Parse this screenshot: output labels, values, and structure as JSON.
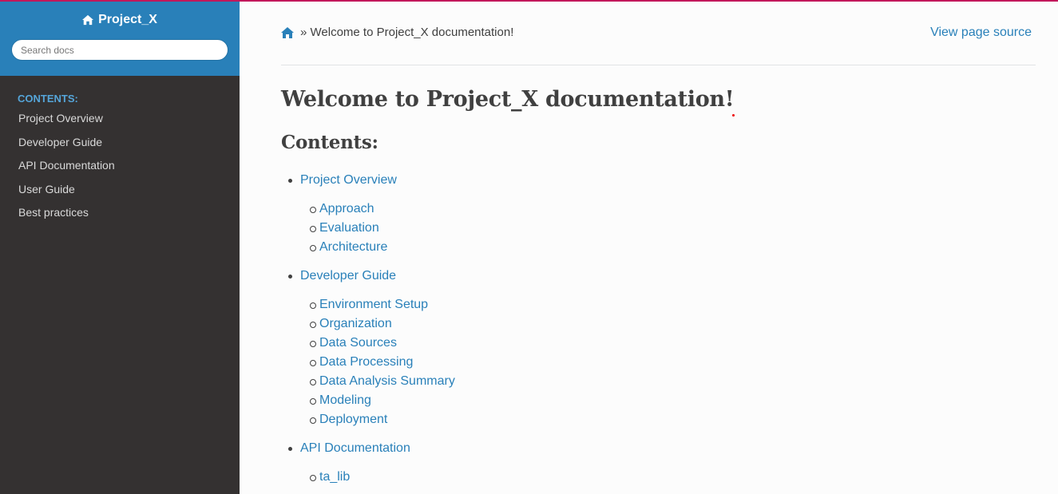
{
  "sidebar": {
    "brand": "Project_X",
    "search_placeholder": "Search docs",
    "caption": "CONTENTS:",
    "items": [
      {
        "label": "Project Overview"
      },
      {
        "label": "Developer Guide"
      },
      {
        "label": "API Documentation"
      },
      {
        "label": "User Guide"
      },
      {
        "label": "Best practices"
      }
    ]
  },
  "breadcrumb": {
    "home_icon": "home-icon",
    "text": "» Welcome to Project_X documentation!",
    "view_source": "View page source"
  },
  "main": {
    "title": "Welcome to Project_X documentation!",
    "contents_heading": "Contents:",
    "toc": [
      {
        "label": "Project Overview",
        "children": [
          "Approach",
          "Evaluation",
          "Architecture"
        ]
      },
      {
        "label": "Developer Guide",
        "children": [
          "Environment Setup",
          "Organization",
          "Data Sources",
          "Data Processing",
          "Data Analysis Summary",
          "Modeling",
          "Deployment"
        ]
      },
      {
        "label": "API Documentation",
        "children": [
          "ta_lib"
        ]
      }
    ]
  },
  "colors": {
    "sidebar_header": "#2980b9",
    "sidebar_bg": "#343131",
    "link": "#2980b9",
    "caption": "#55a5d9",
    "accent_top": "#c2185b"
  }
}
